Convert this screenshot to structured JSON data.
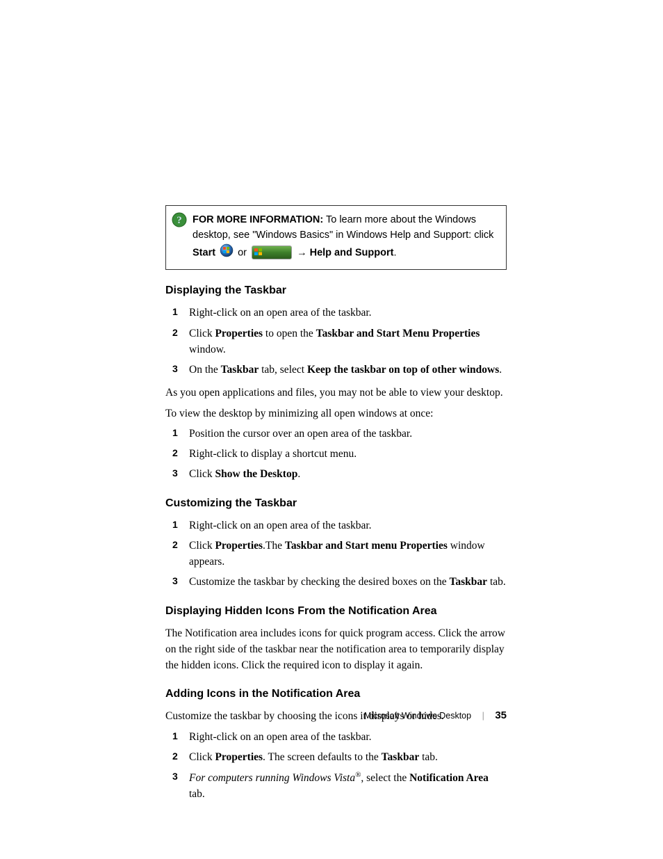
{
  "info_box": {
    "label": "FOR MORE INFORMATION:",
    "text1": " To learn more about the Windows desktop, see \"Windows Basics\" in Windows Help and Support: click ",
    "start_bold": "Start",
    "or": "or",
    "help_support": "Help and Support"
  },
  "section1": {
    "heading": "Displaying the Taskbar",
    "items": {
      "n1": "1",
      "t1": "Right-click on an open area of the taskbar.",
      "n2": "2",
      "t2a": "Click ",
      "t2b": "Properties",
      "t2c": " to open the ",
      "t2d": "Taskbar and Start Menu Properties",
      "t2e": " window.",
      "n3": "3",
      "t3a": "On the ",
      "t3b": "Taskbar",
      "t3c": " tab, select ",
      "t3d": "Keep the taskbar on top of other windows",
      "t3e": "."
    },
    "p1": "As you open applications and files, you may not be able to view your desktop.",
    "p2": "To view the desktop by minimizing all open windows at once:",
    "items2": {
      "n1": "1",
      "t1": "Position the cursor over an open area of the taskbar.",
      "n2": "2",
      "t2": "Right-click to display a shortcut menu.",
      "n3": "3",
      "t3a": "Click ",
      "t3b": "Show the Desktop",
      "t3c": "."
    }
  },
  "section2": {
    "heading": "Customizing the Taskbar",
    "items": {
      "n1": "1",
      "t1": "Right-click on an open area of the taskbar.",
      "n2": "2",
      "t2a": "Click ",
      "t2b": "Properties",
      "t2c": ".The ",
      "t2d": "Taskbar and Start menu Properties",
      "t2e": " window appears.",
      "n3": "3",
      "t3a": "Customize the taskbar by checking the desired boxes on the ",
      "t3b": "Taskbar",
      "t3c": " tab."
    }
  },
  "section3": {
    "heading": "Displaying Hidden Icons From the Notification Area",
    "p1": "The Notification area includes icons for quick program access. Click the arrow on the right side of the taskbar near the notification area to temporarily display the hidden icons. Click the required icon to display it again."
  },
  "section4": {
    "heading": "Adding Icons in the Notification Area",
    "p1": "Customize the taskbar by choosing the icons it displays or hides.",
    "items": {
      "n1": "1",
      "t1": "Right-click on an open area of the taskbar.",
      "n2": "2",
      "t2a": "Click ",
      "t2b": "Properties",
      "t2c": ". The screen defaults to the ",
      "t2d": "Taskbar",
      "t2e": " tab.",
      "n3": "3",
      "t3a": "For computers running Windows Vista",
      "t3b": ", select the ",
      "t3c": "Notification Area",
      "t3d": " tab."
    }
  },
  "footer": {
    "title": "Microsoft Windows Desktop",
    "page": "35"
  }
}
